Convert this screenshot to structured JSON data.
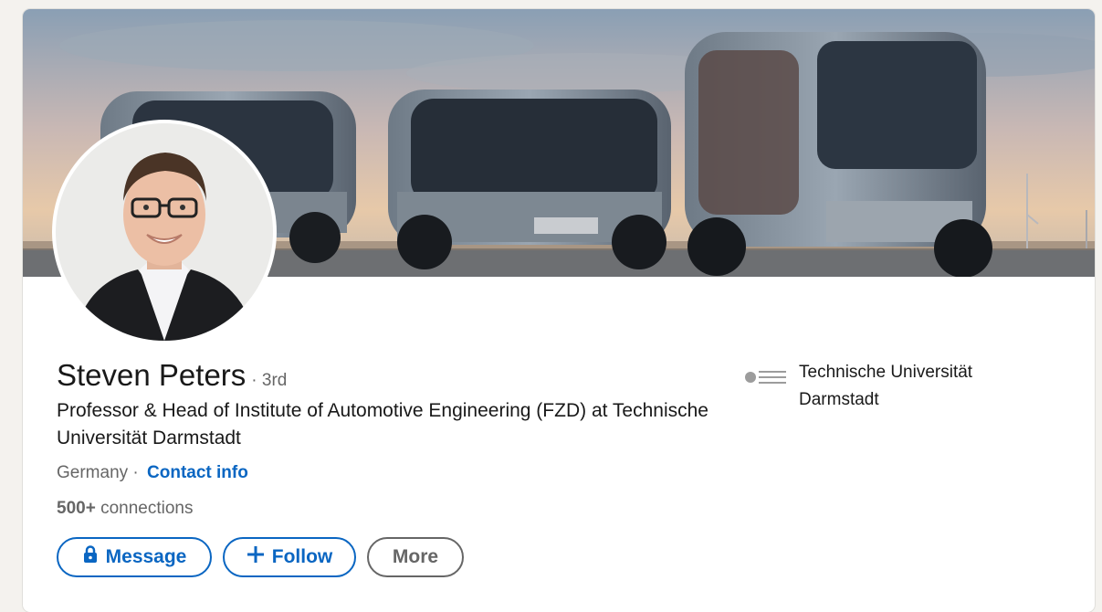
{
  "profile": {
    "name": "Steven Peters",
    "degree": "· 3rd",
    "headline": "Professor & Head of Institute of Automotive Engineering (FZD) at Technische Universität Darmstadt",
    "location": "Germany ·",
    "contact_info": "Contact info",
    "connections_count": "500+",
    "connections_label": "connections"
  },
  "actions": {
    "message": "Message",
    "follow": "Follow",
    "more": "More"
  },
  "organization": {
    "name": "Technische Universität Darmstadt",
    "logo_text": "TECHNISCHE UNIVERSITÄT DARMSTADT"
  },
  "icons": {
    "message": "lock-icon",
    "follow": "plus-icon"
  },
  "colors": {
    "accent": "#0a66c2",
    "secondary": "#666666",
    "text": "#191919",
    "page_bg": "#f4f2ee"
  }
}
